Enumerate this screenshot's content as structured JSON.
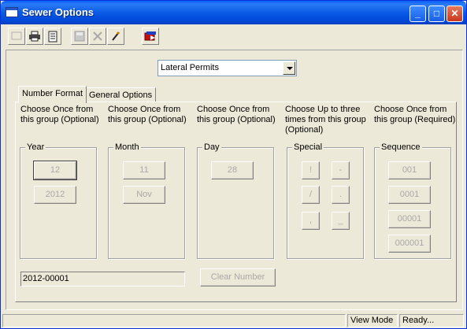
{
  "window": {
    "title": "Sewer Options",
    "controls": {
      "minimize": "_",
      "maximize": "□",
      "close": "✕"
    }
  },
  "toolbar": {
    "icons": [
      "new-icon",
      "print-icon",
      "preview-icon",
      "save-icon",
      "cancel-icon",
      "edit-icon",
      "exit-icon"
    ]
  },
  "permit_type": {
    "selected": "Lateral Permits"
  },
  "tabs": [
    {
      "label": "Number Format",
      "active": true
    },
    {
      "label": "General Options",
      "active": false
    }
  ],
  "columns": [
    {
      "instruction": "Choose Once from this group (Optional)",
      "group": "Year",
      "buttons": [
        "12",
        "2012"
      ]
    },
    {
      "instruction": "Choose Once from this group (Optional)",
      "group": "Month",
      "buttons": [
        "11",
        "Nov"
      ]
    },
    {
      "instruction": "Choose Once from this group (Optional)",
      "group": "Day",
      "buttons": [
        "28"
      ]
    },
    {
      "instruction": "Choose Up to three times from this group (Optional)",
      "group": "Special",
      "buttons": [
        "!",
        "-",
        "/",
        ".",
        ",",
        "_"
      ]
    },
    {
      "instruction": "Choose Once from this group (Required)",
      "group": "Sequence",
      "buttons": [
        "001",
        "0001",
        "00001",
        "000001"
      ]
    }
  ],
  "number_preview": "2012-00001",
  "clear_button": "Clear Number",
  "status": {
    "mode": "View Mode",
    "message": "Ready..."
  }
}
